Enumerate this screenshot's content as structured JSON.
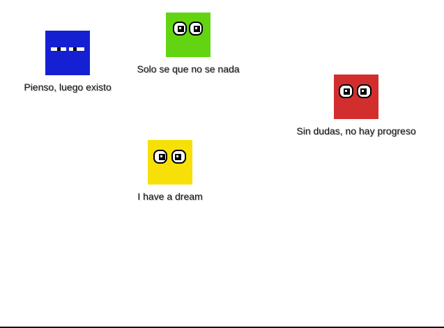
{
  "characters": [
    {
      "id": "blue",
      "caption": "Pienso, luego existo",
      "body_color": "#1420d2",
      "eyes": "closed"
    },
    {
      "id": "green",
      "caption": "Solo se que no se nada",
      "body_color": "#62d412",
      "eyes": "open"
    },
    {
      "id": "red",
      "caption": "Sin dudas, no hay progreso",
      "body_color": "#d22e2e",
      "eyes": "open"
    },
    {
      "id": "yellow",
      "caption": "I have a dream",
      "body_color": "#f7e008",
      "eyes": "open"
    }
  ]
}
